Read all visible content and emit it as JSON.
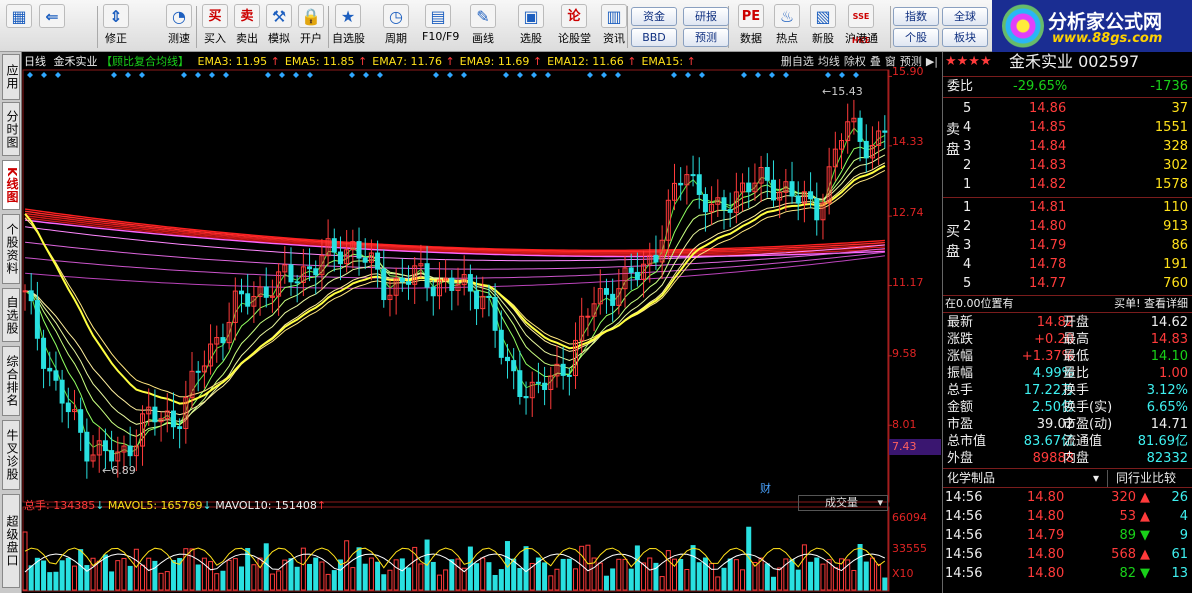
{
  "toolbar": {
    "buttons": [
      {
        "label": "",
        "icon": "grid-icon"
      },
      {
        "label": "",
        "icon": "back-arrow-icon"
      },
      {
        "label": "修正",
        "icon": "up-down-icon"
      },
      {
        "label": "测速",
        "icon": "speed-icon"
      },
      {
        "label": "买入",
        "icon_text": "买"
      },
      {
        "label": "卖出",
        "icon_text": "卖"
      },
      {
        "label": "模拟",
        "icon": "hammer-icon"
      },
      {
        "label": "开户",
        "icon": "lock-icon"
      },
      {
        "label": "自选股",
        "icon": "star-icon"
      },
      {
        "label": "周期",
        "icon": "clock-icon"
      },
      {
        "label": "F10/F9",
        "icon": "f10-icon"
      },
      {
        "label": "画线",
        "icon": "pencil-icon"
      },
      {
        "label": "选股",
        "icon": "select-icon"
      },
      {
        "label": "论股堂",
        "icon_text": "论"
      },
      {
        "label": "资讯",
        "icon": "news-icon"
      },
      {
        "label": "数据",
        "icon_text": "PE"
      },
      {
        "label": "热点",
        "icon": "fire-icon"
      },
      {
        "label": "新股",
        "icon": "newstock-icon"
      },
      {
        "label": "沪港通",
        "icon_text": "SSE HKE"
      }
    ],
    "pills": [
      "资金",
      "研报",
      "BBD",
      "预测",
      "指数",
      "全球",
      "个股",
      "板块"
    ]
  },
  "logo": {
    "title": "分析家公式网",
    "url": "www.88gs.com"
  },
  "left_tabs": [
    "应用",
    "分时图",
    "K线图",
    "个股资料",
    "自选股",
    "综合排名",
    "牛叉诊股",
    "超级盘口"
  ],
  "kline": {
    "period": "日线",
    "name": "金禾实业",
    "indicator": "【顾比复合均线】",
    "ema": [
      {
        "label": "EMA3: 11.95",
        "color": "#ffe11a"
      },
      {
        "label": "EMA5: 11.85",
        "color": "#ffe11a"
      },
      {
        "label": "EMA7: 11.76",
        "color": "#ffe11a"
      },
      {
        "label": "EMA9: 11.69",
        "color": "#ffe11a"
      },
      {
        "label": "EMA12: 11.66",
        "color": "#ffe11a"
      },
      {
        "label": "EMA15:",
        "color": "#ffe11a"
      }
    ],
    "tools": [
      "删自选",
      "均线",
      "除权",
      "叠",
      "窗",
      "预测"
    ],
    "price_high_label": "15.43",
    "price_low_label": "6.89",
    "y_labels": [
      "15.90",
      "14.33",
      "12.74",
      "11.17",
      "9.58",
      "8.01"
    ],
    "current_price_box": "7.43",
    "marker": "财"
  },
  "volume": {
    "total": "总手: 134385",
    "mavol5": "MAVOL5: 165769",
    "mavol10": "MAVOL10: 151408",
    "selector": "成交量",
    "y_labels": [
      "66094",
      "33555",
      "X10"
    ]
  },
  "quote": {
    "stock_name": "金禾实业",
    "stock_code": "002597",
    "weibi_label": "委比",
    "weibi": "-29.65%",
    "weicha": "-1736",
    "sell_label": "卖盘",
    "buy_label": "买盘",
    "asks": [
      {
        "n": "5",
        "p": "14.86",
        "v": "37"
      },
      {
        "n": "4",
        "p": "14.85",
        "v": "1551"
      },
      {
        "n": "3",
        "p": "14.84",
        "v": "328"
      },
      {
        "n": "2",
        "p": "14.83",
        "v": "302"
      },
      {
        "n": "1",
        "p": "14.82",
        "v": "1578"
      }
    ],
    "bids": [
      {
        "n": "1",
        "p": "14.81",
        "v": "110"
      },
      {
        "n": "2",
        "p": "14.80",
        "v": "913"
      },
      {
        "n": "3",
        "p": "14.79",
        "v": "86"
      },
      {
        "n": "4",
        "p": "14.78",
        "v": "191"
      },
      {
        "n": "5",
        "p": "14.77",
        "v": "760"
      }
    ],
    "pos_note": "在0.00位置有",
    "pos_right": "买单! 查看详细",
    "stats": [
      {
        "l1": "最新",
        "v1": "14.82",
        "c1": "red",
        "l2": "开盘",
        "v2": "14.62",
        "c2": "wht"
      },
      {
        "l1": "涨跌",
        "v1": "+0.20",
        "c1": "red",
        "l2": "最高",
        "v2": "14.83",
        "c2": "red"
      },
      {
        "l1": "涨幅",
        "v1": "+1.37%",
        "c1": "red",
        "l2": "最低",
        "v2": "14.10",
        "c2": "grn"
      },
      {
        "l1": "振幅",
        "v1": "4.99%",
        "c1": "cyn",
        "l2": "量比",
        "v2": "1.00",
        "c2": "red"
      },
      {
        "l1": "总手",
        "v1": "17.22万",
        "c1": "cyn",
        "l2": "换手",
        "v2": "3.12%",
        "c2": "cyn"
      },
      {
        "l1": "金额",
        "v1": "2.50亿",
        "c1": "cyn",
        "l2": "换手(实)",
        "v2": "6.65%",
        "c2": "cyn"
      },
      {
        "l1": "市盈",
        "v1": "39.02",
        "c1": "wht",
        "l2": "市盈(动)",
        "v2": "14.71",
        "c2": "wht"
      },
      {
        "l1": "总市值",
        "v1": "83.67亿",
        "c1": "cyn",
        "l2": "流通值",
        "v2": "81.69亿",
        "c2": "cyn"
      },
      {
        "l1": "外盘",
        "v1": "89888",
        "c1": "red",
        "l2": "内盘",
        "v2": "82332",
        "c2": "cyn"
      }
    ],
    "industry": "化学制品",
    "industry_cmp": "同行业比较",
    "ticks": [
      {
        "t": "14:56",
        "p": "14.80",
        "v": "320",
        "dir": "up",
        "x": "26"
      },
      {
        "t": "14:56",
        "p": "14.80",
        "v": "53",
        "dir": "up",
        "x": "4"
      },
      {
        "t": "14:56",
        "p": "14.79",
        "v": "89",
        "dir": "down",
        "x": "9"
      },
      {
        "t": "14:56",
        "p": "14.80",
        "v": "568",
        "dir": "up",
        "x": "61"
      },
      {
        "t": "14:56",
        "p": "14.80",
        "v": "82",
        "dir": "down",
        "x": "13"
      }
    ]
  },
  "chart_data": {
    "type": "candlestick",
    "title": "金禾实业 日线 顾比复合均线",
    "ylim": [
      6.5,
      16.0
    ],
    "y_ticks": [
      15.9,
      14.33,
      12.74,
      11.17,
      9.58,
      8.01
    ],
    "annotations": [
      {
        "text": "15.43",
        "value": 15.43
      },
      {
        "text": "6.89",
        "value": 6.89
      }
    ],
    "ema_values": {
      "EMA3": 11.95,
      "EMA5": 11.85,
      "EMA7": 11.76,
      "EMA9": 11.69,
      "EMA12": 11.66
    },
    "volume": {
      "total": 134385,
      "MAVOL5": 165769,
      "MAVOL10": 151408,
      "y_ticks": [
        66094,
        33555
      ]
    }
  }
}
